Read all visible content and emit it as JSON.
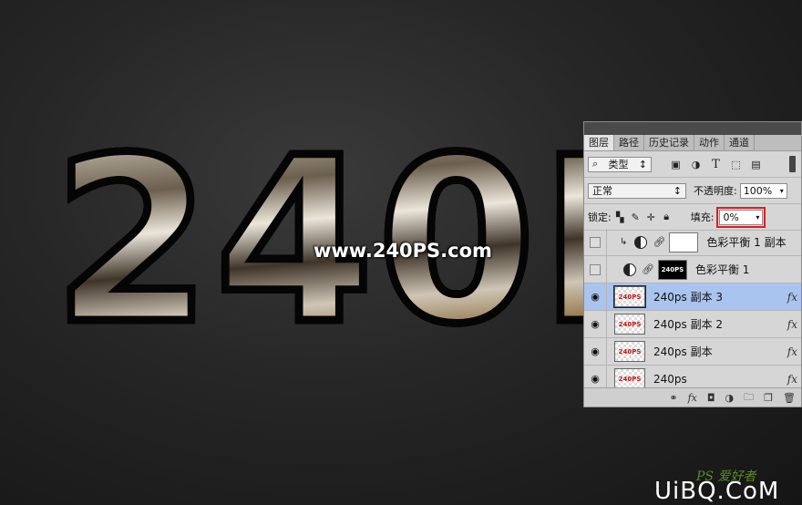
{
  "canvas": {
    "art_text": "240P",
    "watermark": "www.240PS.com",
    "site_logo_tag": "PS 爱好者",
    "site_logo_brand": "UiBQ.CoM"
  },
  "panel": {
    "tabs": [
      {
        "label": "图层",
        "active": true
      },
      {
        "label": "路径",
        "active": false
      },
      {
        "label": "历史记录",
        "active": false
      },
      {
        "label": "动作",
        "active": false
      },
      {
        "label": "通道",
        "active": false
      }
    ],
    "filter": {
      "kind_label": "类型",
      "icons": [
        "image-filter-icon",
        "adjustment-filter-icon",
        "type-filter-icon",
        "shape-filter-icon",
        "smart-object-filter-icon"
      ]
    },
    "blend": {
      "mode": "正常",
      "opacity_label": "不透明度:",
      "opacity_value": "100%"
    },
    "lock": {
      "label": "锁定:",
      "fill_label": "填充:",
      "fill_value": "0%"
    },
    "layers": [
      {
        "name": "色彩平衡 1 副本",
        "type": "adjustment-clipped",
        "visible": false,
        "selected": false
      },
      {
        "name": "色彩平衡 1",
        "type": "adjustment",
        "visible": false,
        "selected": false,
        "mask_text": "240PS"
      },
      {
        "name": "240ps 副本 3",
        "type": "text",
        "visible": true,
        "selected": true,
        "thumb_text": "240PS",
        "fx": "fx"
      },
      {
        "name": "240ps 副本 2",
        "type": "text",
        "visible": true,
        "selected": false,
        "thumb_text": "240PS",
        "fx": "fx"
      },
      {
        "name": "240ps 副本",
        "type": "text",
        "visible": true,
        "selected": false,
        "thumb_text": "240PS",
        "fx": "fx"
      },
      {
        "name": "240ps",
        "type": "text",
        "visible": true,
        "selected": false,
        "thumb_text": "240PS",
        "fx": "fx"
      }
    ],
    "bottom_icons": {
      "fx_label": "fx"
    },
    "colors": {
      "selected_row": "#a9c4ef",
      "highlight": "#e21c1c"
    }
  }
}
